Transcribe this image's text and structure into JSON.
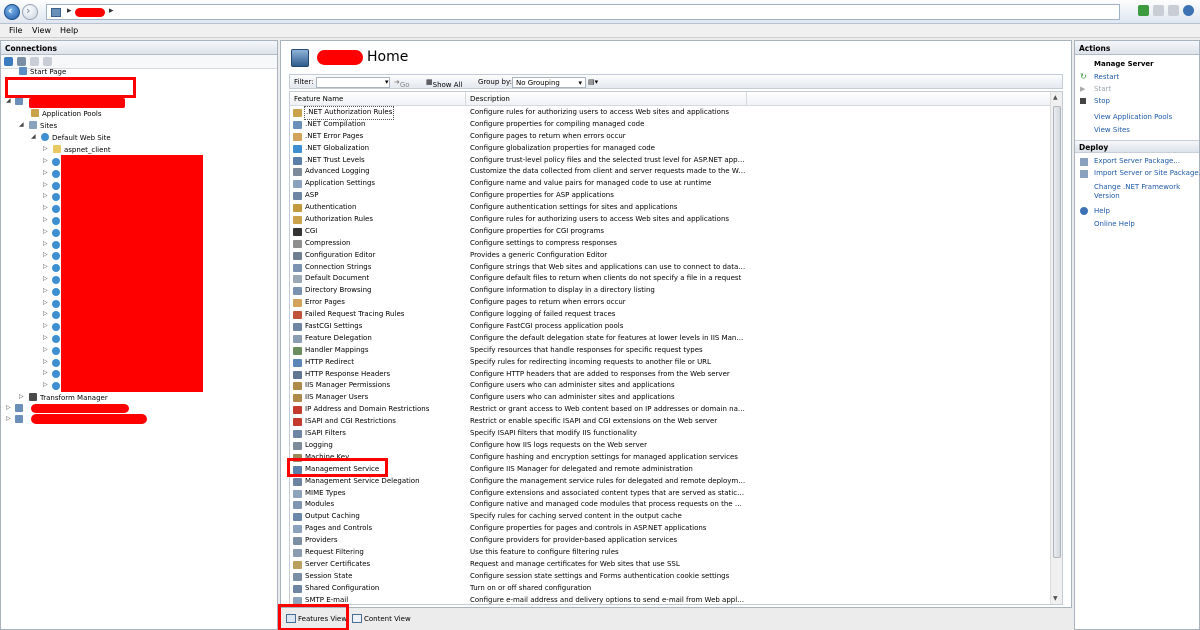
{
  "menu": [
    "File",
    "View",
    "Help"
  ],
  "connections": {
    "title": "Connections",
    "start_page": "Start Page",
    "application_pools": "Application Pools",
    "sites": "Sites",
    "default_web_site": "Default Web Site",
    "aspnet_client": "aspnet_client",
    "transform_manager": "Transform Manager"
  },
  "center": {
    "title": "Home",
    "filter_label": "Filter:",
    "go_label": "Go",
    "show_all_label": "Show All",
    "group_by_label": "Group by:",
    "group_by_value": "No Grouping",
    "col_feature": "Feature Name",
    "col_description": "Description",
    "features": [
      {
        "name": ".NET Authorization Rules",
        "desc": "Configure rules for authorizing users to access Web sites and applications",
        "color": "#c9a24a"
      },
      {
        "name": ".NET Compilation",
        "desc": "Configure properties for compiling managed code",
        "color": "#6a8fb9"
      },
      {
        "name": ".NET Error Pages",
        "desc": "Configure pages to return when errors occur",
        "color": "#d4a35a"
      },
      {
        "name": ".NET Globalization",
        "desc": "Configure globalization properties for managed code",
        "color": "#3d8fd1"
      },
      {
        "name": ".NET Trust Levels",
        "desc": "Configure trust-level policy files and the selected trust level for ASP.NET applicati...",
        "color": "#5b7fa8"
      },
      {
        "name": "Advanced Logging",
        "desc": "Customize the data collected from client and server requests made to the Web se...",
        "color": "#7d8a99"
      },
      {
        "name": "Application Settings",
        "desc": "Configure name and value pairs for managed code to use at runtime",
        "color": "#8aa2bd"
      },
      {
        "name": "ASP",
        "desc": "Configure properties for ASP applications",
        "color": "#6e86a3"
      },
      {
        "name": "Authentication",
        "desc": "Configure authentication settings for sites and applications",
        "color": "#c49a3f"
      },
      {
        "name": "Authorization Rules",
        "desc": "Configure rules for authorizing users to access Web sites and applications",
        "color": "#c9a24a"
      },
      {
        "name": "CGI",
        "desc": "Configure properties for CGI programs",
        "color": "#333333"
      },
      {
        "name": "Compression",
        "desc": "Configure settings to compress responses",
        "color": "#8e8e8e"
      },
      {
        "name": "Configuration Editor",
        "desc": "Provides a generic Configuration Editor",
        "color": "#6f7f91"
      },
      {
        "name": "Connection Strings",
        "desc": "Configure strings that Web sites and applications can use to connect to data sour...",
        "color": "#7b93b0"
      },
      {
        "name": "Default Document",
        "desc": "Configure default files to return when clients do not specify a file in a request",
        "color": "#9aa7b5"
      },
      {
        "name": "Directory Browsing",
        "desc": "Configure information to display in a directory listing",
        "color": "#7892b0"
      },
      {
        "name": "Error Pages",
        "desc": "Configure pages to return when errors occur",
        "color": "#d4a35a"
      },
      {
        "name": "Failed Request Tracing Rules",
        "desc": "Configure logging of failed request traces",
        "color": "#c0533a"
      },
      {
        "name": "FastCGI Settings",
        "desc": "Configure FastCGI process application pools",
        "color": "#6e86a3"
      },
      {
        "name": "Feature Delegation",
        "desc": "Configure the default delegation state for features at lower levels in IIS Manager",
        "color": "#8a9db3"
      },
      {
        "name": "Handler Mappings",
        "desc": "Specify resources that handle responses for specific request types",
        "color": "#6b8e5e"
      },
      {
        "name": "HTTP Redirect",
        "desc": "Specify rules for redirecting incoming requests to another file or URL",
        "color": "#5c86b8"
      },
      {
        "name": "HTTP Response Headers",
        "desc": "Configure HTTP headers that are added to responses from the Web server",
        "color": "#5f7793"
      },
      {
        "name": "IIS Manager Permissions",
        "desc": "Configure users who can administer sites and applications",
        "color": "#b08a48"
      },
      {
        "name": "IIS Manager Users",
        "desc": "Configure users who can administer sites and applications",
        "color": "#b08a48"
      },
      {
        "name": "IP Address and Domain Restrictions",
        "desc": "Restrict or grant access to Web content based on IP addresses or domain names",
        "color": "#c23b2c"
      },
      {
        "name": "ISAPI and CGI Restrictions",
        "desc": "Restrict or enable specific ISAPI and CGI extensions on the Web server",
        "color": "#c23b2c"
      },
      {
        "name": "ISAPI Filters",
        "desc": "Specify ISAPI filters that modify IIS functionality",
        "color": "#6e86a3"
      },
      {
        "name": "Logging",
        "desc": "Configure how IIS logs requests on the Web server",
        "color": "#7d8a99"
      },
      {
        "name": "Machine Key",
        "desc": "Configure hashing and encryption settings for managed application services",
        "color": "#9b8b5a"
      },
      {
        "name": "Management Service",
        "desc": "Configure IIS Manager for delegated and remote administration",
        "color": "#5b7fa8"
      },
      {
        "name": "Management Service Delegation",
        "desc": "Configure the management service rules for delegated and remote deployments",
        "color": "#6d84a0"
      },
      {
        "name": "MIME Types",
        "desc": "Configure extensions and associated content types that are served as static files",
        "color": "#8ea4bd"
      },
      {
        "name": "Modules",
        "desc": "Configure native and managed code modules that process requests on the Web ...",
        "color": "#7f96b2"
      },
      {
        "name": "Output Caching",
        "desc": "Specify rules for caching served content in the output cache",
        "color": "#6c89ab"
      },
      {
        "name": "Pages and Controls",
        "desc": "Configure properties for pages and controls in ASP.NET applications",
        "color": "#8aa2bd"
      },
      {
        "name": "Providers",
        "desc": "Configure providers for provider-based application services",
        "color": "#7d8fa4"
      },
      {
        "name": "Request Filtering",
        "desc": "Use this feature to configure filtering rules",
        "color": "#8b9cb0"
      },
      {
        "name": "Server Certificates",
        "desc": "Request and manage certificates for Web sites that use SSL",
        "color": "#b9a05c"
      },
      {
        "name": "Session State",
        "desc": "Configure session state settings and Forms authentication cookie settings",
        "color": "#7a8ea6"
      },
      {
        "name": "Shared Configuration",
        "desc": "Turn on or off shared configuration",
        "color": "#6e86a3"
      },
      {
        "name": "SMTP E-mail",
        "desc": "Configure e-mail address and delivery options to send e-mail from Web applicati...",
        "color": "#8ea4bd"
      }
    ]
  },
  "bottom": {
    "features_view": "Features View",
    "content_view": "Content View"
  },
  "actions": {
    "title": "Actions",
    "manage_server": "Manage Server",
    "restart": "Restart",
    "start": "Start",
    "stop": "Stop",
    "view_app_pools": "View Application Pools",
    "view_sites": "View Sites",
    "deploy": "Deploy",
    "export_server": "Export Server Package...",
    "import_server": "Import Server or Site Package...",
    "change_framework_1": "Change .NET Framework",
    "change_framework_2": "Version",
    "help": "Help",
    "online_help": "Online Help"
  },
  "colors": {
    "highlight": "#ff0000",
    "redaction": "#ff0000",
    "link": "#1e5aa8"
  }
}
